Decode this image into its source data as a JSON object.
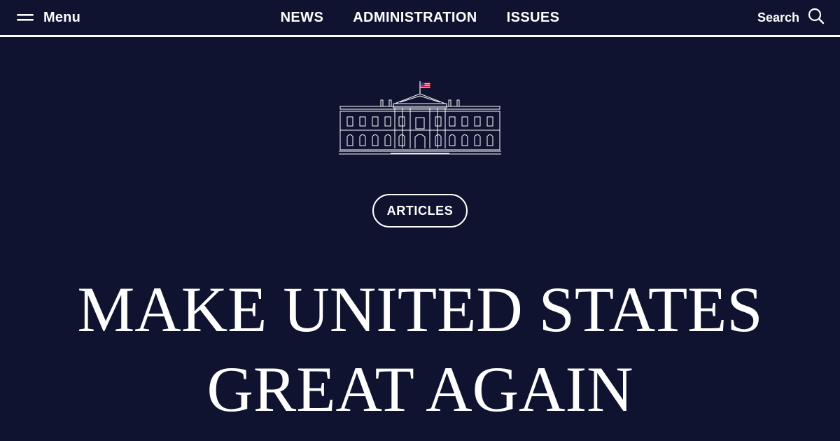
{
  "header": {
    "menu_label": "Menu",
    "nav": [
      {
        "label": "NEWS"
      },
      {
        "label": "ADMINISTRATION"
      },
      {
        "label": "ISSUES"
      }
    ],
    "search_label": "Search"
  },
  "icons": {
    "menu": "hamburger-icon",
    "search": "search-icon",
    "emblem": "white-house-icon",
    "flag": "us-flag-icon"
  },
  "colors": {
    "background": "#0f1330",
    "foreground": "#ffffff",
    "flag_red": "#c8102e",
    "flag_blue": "#2a3b8f"
  },
  "article": {
    "category": "ARTICLES",
    "title": "MAKE UNITED STATES GREAT AGAIN"
  }
}
